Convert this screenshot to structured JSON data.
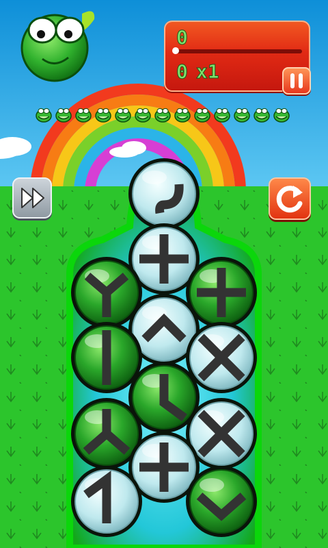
{
  "hud": {
    "score": "0",
    "progress_fraction": 0.0,
    "level_score": "0",
    "multiplier": "x1"
  },
  "lives": {
    "count": 13
  },
  "colors": {
    "sky": "#1fa9e6",
    "grass": "#2cc52c",
    "hud_red": "#e12a14",
    "score_green": "#7fe26d"
  },
  "icons": {
    "pause": "pause-icon",
    "fast_forward": "fast-forward-icon",
    "restart": "restart-icon",
    "mascot": "frog-mascot"
  },
  "board": {
    "bubbles": [
      {
        "kind": "glass",
        "symbol": "curve-down"
      },
      {
        "kind": "glass",
        "symbol": "plus"
      },
      {
        "kind": "green",
        "symbol": "y-fork"
      },
      {
        "kind": "green",
        "symbol": "plus"
      },
      {
        "kind": "glass",
        "symbol": "caret-up"
      },
      {
        "kind": "green",
        "symbol": "vertical-bar"
      },
      {
        "kind": "glass",
        "symbol": "cross"
      },
      {
        "kind": "green",
        "symbol": "corner-l"
      },
      {
        "kind": "green",
        "symbol": "y-inverted"
      },
      {
        "kind": "glass",
        "symbol": "cross"
      },
      {
        "kind": "glass",
        "symbol": "plus"
      },
      {
        "kind": "glass",
        "symbol": "angle-l"
      },
      {
        "kind": "green",
        "symbol": "chevron-down"
      }
    ]
  }
}
